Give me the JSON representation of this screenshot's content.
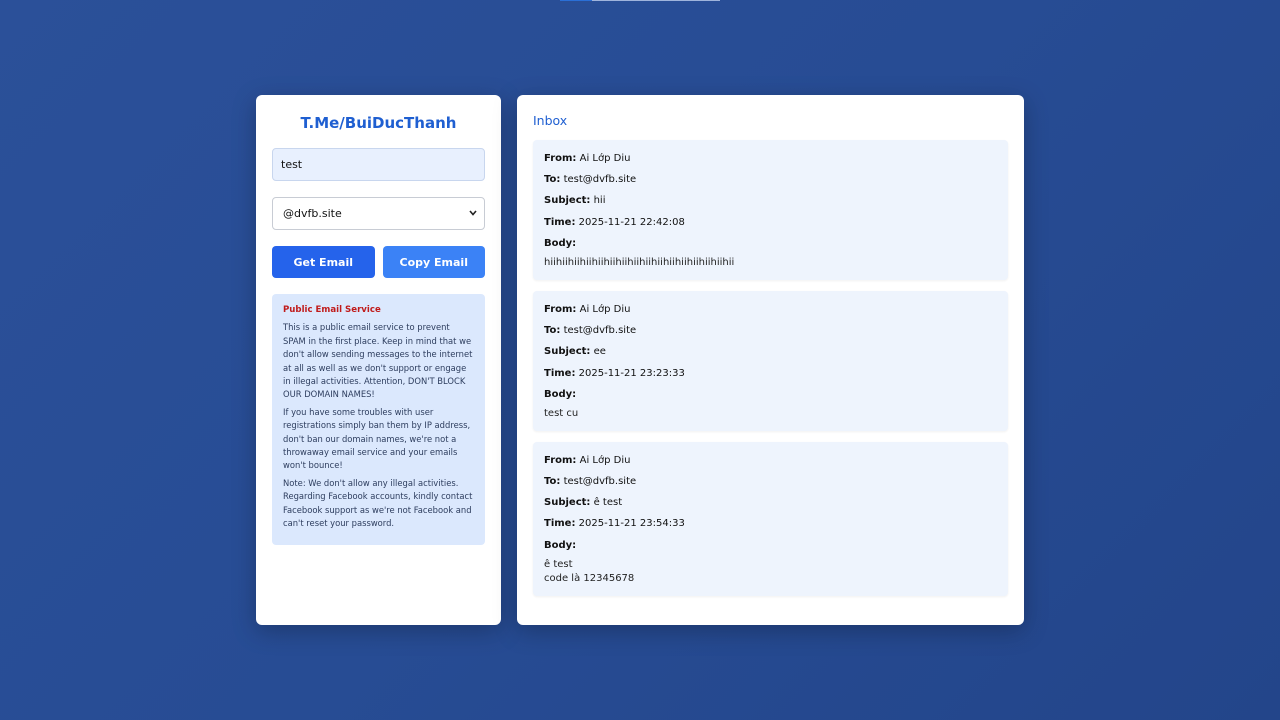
{
  "brand": "T.Me/BuiDucThanh",
  "form": {
    "username_value": "test",
    "domain_selected": "@dvfb.site",
    "get_label": "Get Email",
    "copy_label": "Copy Email"
  },
  "notice": {
    "title": "Public Email Service",
    "paragraphs": [
      "This is a public email service to prevent SPAM in the first place. Keep in mind that we don't allow sending messages to the internet at all as well as we don't support or engage in illegal activities. Attention, DON'T BLOCK OUR DOMAIN NAMES!",
      "If you have some troubles with user registrations simply ban them by IP address, don't ban our domain names, we're not a throwaway email service and your emails won't bounce!",
      "Note: We don't allow any illegal activities. Regarding Facebook accounts, kindly contact Facebook support as we're not Facebook and can't reset your password."
    ]
  },
  "inbox": {
    "title": "Inbox",
    "labels": {
      "from": "From:",
      "to": "To:",
      "subject": "Subject:",
      "time": "Time:",
      "body": "Body:"
    },
    "messages": [
      {
        "from": "Ai Lớp Diu",
        "to": "test@dvfb.site",
        "subject": "hii",
        "time": "2025-11-21 22:42:08",
        "body": "hiihiihiihiihiihiihiihiihiihiihiihiihiihiihiihii"
      },
      {
        "from": "Ai Lớp Diu",
        "to": "test@dvfb.site",
        "subject": "ee",
        "time": "2025-11-21 23:23:33",
        "body": "test cu"
      },
      {
        "from": "Ai Lớp Diu",
        "to": "test@dvfb.site",
        "subject": "ê test",
        "time": "2025-11-21 23:54:33",
        "body": "ê test\ncode là 12345678"
      }
    ]
  }
}
